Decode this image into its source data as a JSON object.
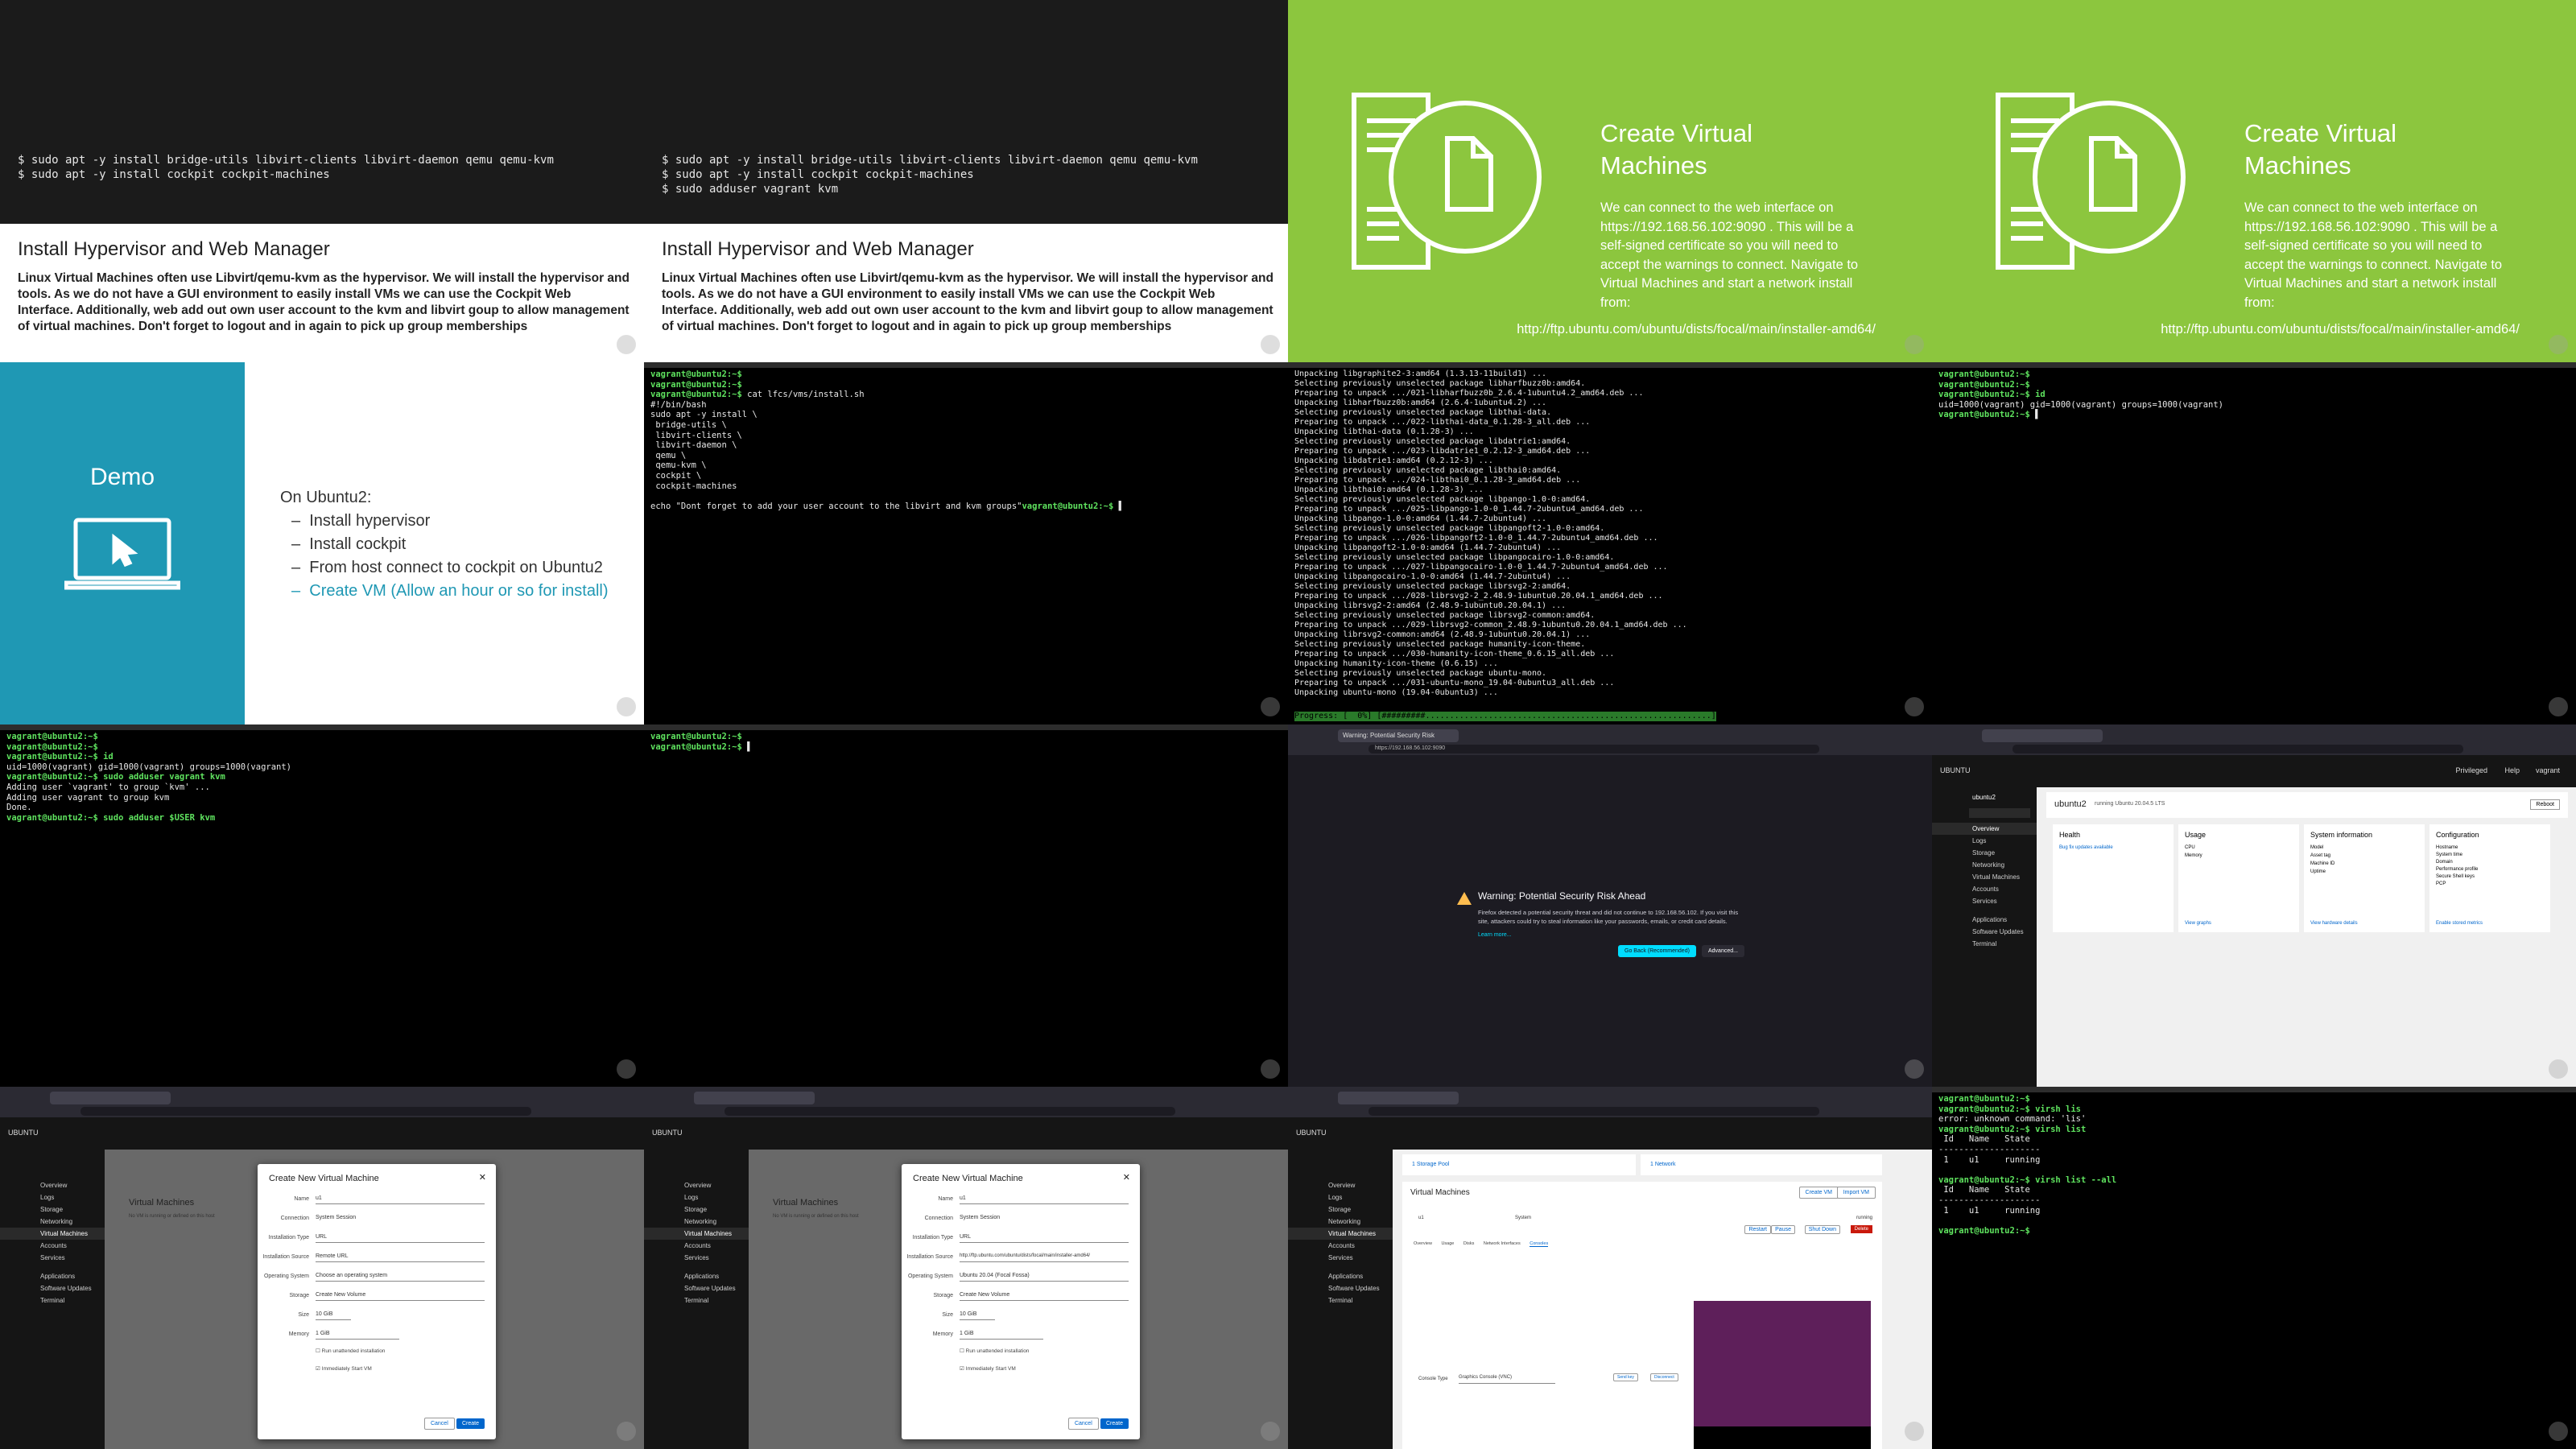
{
  "cells": {
    "c1": {
      "code": "$ sudo apt -y install bridge-utils libvirt-clients libvirt-daemon qemu qemu-kvm\n$ sudo apt -y install cockpit cockpit-machines",
      "title": "Install Hypervisor and Web Manager",
      "body": "Linux Virtual Machines often use Libvirt/qemu-kvm as the hypervisor. We will install the hypervisor and tools. As we do not have a GUI environment to easily install VMs we can use the Cockpit Web Interface. Additionally, web add out own user account to the kvm and libvirt goup to allow management of virtual machines. Don't forget to logout and in again to pick up group memberships"
    },
    "c2": {
      "code": "$ sudo apt -y install bridge-utils libvirt-clients libvirt-daemon qemu qemu-kvm\n$ sudo apt -y install cockpit cockpit-machines\n$ sudo adduser vagrant kvm",
      "title": "Install Hypervisor and Web Manager",
      "body": "Linux Virtual Machines often use Libvirt/qemu-kvm as the hypervisor. We will install the hypervisor and tools. As we do not have a GUI environment to easily install VMs we can use the Cockpit Web Interface. Additionally, web add out own user account to the kvm and libvirt goup to allow management of virtual machines. Don't forget to logout and in again to pick up group memberships"
    },
    "c3": {
      "title": "Create Virtual Machines",
      "text": "We can connect to the web interface on https://192.168.56.102:9090 . This will be a self-signed certificate so you will need to accept the warnings to connect. Navigate to Virtual Machines and start a network install from:",
      "url": "http://ftp.ubuntu.com/ubuntu/dists/focal/main/installer-amd64/"
    },
    "c4": {
      "title": "Create Virtual Machines",
      "text": "We can connect to the web interface on https://192.168.56.102:9090 . This will be a self-signed certificate so you will need to accept the warnings to connect. Navigate to Virtual Machines and start a network install from:",
      "url": "http://ftp.ubuntu.com/ubuntu/dists/focal/main/installer-amd64/"
    },
    "c5": {
      "title": "Demo",
      "intro": "On Ubuntu2:",
      "items": [
        "Install hypervisor",
        "Install cockpit",
        "From host connect to cockpit on Ubuntu2",
        "Create VM (Allow an hour or so for install)"
      ]
    },
    "c6": {
      "prompt": "vagrant@ubuntu2:~$",
      "lines": [
        "",
        "",
        " cat lfcs/vms/install.sh",
        "#!/bin/bash",
        "sudo apt -y install \\",
        " bridge-utils \\",
        " libvirt-clients \\",
        " libvirt-daemon \\",
        " qemu \\",
        " qemu-kvm \\",
        " cockpit \\",
        " cockpit-machines",
        "",
        "echo \"Dont forget to add your user account to the libvirt and kvm groups\""
      ]
    },
    "c7": {
      "output": "Unpacking libgraphite2-3:amd64 (1.3.13-11build1) ...\nSelecting previously unselected package libharfbuzz0b:amd64.\nPreparing to unpack .../021-libharfbuzz0b_2.6.4-1ubuntu4.2_amd64.deb ...\nUnpacking libharfbuzz0b:amd64 (2.6.4-1ubuntu4.2) ...\nSelecting previously unselected package libthai-data.\nPreparing to unpack .../022-libthai-data_0.1.28-3_all.deb ...\nUnpacking libthai-data (0.1.28-3) ...\nSelecting previously unselected package libdatrie1:amd64.\nPreparing to unpack .../023-libdatrie1_0.2.12-3_amd64.deb ...\nUnpacking libdatrie1:amd64 (0.2.12-3) ...\nSelecting previously unselected package libthai0:amd64.\nPreparing to unpack .../024-libthai0_0.1.28-3_amd64.deb ...\nUnpacking libthai0:amd64 (0.1.28-3) ...\nSelecting previously unselected package libpango-1.0-0:amd64.\nPreparing to unpack .../025-libpango-1.0-0_1.44.7-2ubuntu4_amd64.deb ...\nUnpacking libpango-1.0-0:amd64 (1.44.7-2ubuntu4) ...\nSelecting previously unselected package libpangoft2-1.0-0:amd64.\nPreparing to unpack .../026-libpangoft2-1.0-0_1.44.7-2ubuntu4_amd64.deb ...\nUnpacking libpangoft2-1.0-0:amd64 (1.44.7-2ubuntu4) ...\nSelecting previously unselected package libpangocairo-1.0-0:amd64.\nPreparing to unpack .../027-libpangocairo-1.0-0_1.44.7-2ubuntu4_amd64.deb ...\nUnpacking libpangocairo-1.0-0:amd64 (1.44.7-2ubuntu4) ...\nSelecting previously unselected package librsvg2-2:amd64.\nPreparing to unpack .../028-librsvg2-2_2.48.9-1ubuntu0.20.04.1_amd64.deb ...\nUnpacking librsvg2-2:amd64 (2.48.9-1ubuntu0.20.04.1) ...\nSelecting previously unselected package librsvg2-common:amd64.\nPreparing to unpack .../029-librsvg2-common_2.48.9-1ubuntu0.20.04.1_amd64.deb ...\nUnpacking librsvg2-common:amd64 (2.48.9-1ubuntu0.20.04.1) ...\nSelecting previously unselected package humanity-icon-theme.\nPreparing to unpack .../030-humanity-icon-theme_0.6.15_all.deb ...\nUnpacking humanity-icon-theme (0.6.15) ...\nSelecting previously unselected package ubuntu-mono.\nPreparing to unpack .../031-ubuntu-mono_19.04-0ubuntu3_all.deb ...\nUnpacking ubuntu-mono (19.04-0ubuntu3) ...",
      "progress": "Progress: [  0%] [#########...........................................................]"
    },
    "c8": {
      "lines": [
        "vagrant@ubuntu2:~$",
        "vagrant@ubuntu2:~$ id",
        "uid=1000(vagrant) gid=1000(vagrant) groups=1000(vagrant)",
        "vagrant@ubuntu2:~$"
      ]
    },
    "c9": {
      "lines": [
        "vagrant@ubuntu2:~$",
        "vagrant@ubuntu2:~$",
        "vagrant@ubuntu2:~$ id",
        "uid=1000(vagrant) gid=1000(vagrant) groups=1000(vagrant)",
        "vagrant@ubuntu2:~$ sudo adduser vagrant kvm",
        "Adding user `vagrant' to group `kvm' ...",
        "Adding user vagrant to group kvm",
        "Done.",
        "vagrant@ubuntu2:~$ sudo adduser $USER kvm"
      ]
    },
    "c10": {
      "lines": [
        "vagrant@ubuntu2:~$",
        "vagrant@ubuntu2:~$"
      ]
    },
    "c11": {
      "tab": "Warning: Potential Security Risk",
      "url": "https://192.168.56.102:9090",
      "title": "Warning: Potential Security Risk Ahead",
      "text": "Firefox detected a potential security threat and did not continue to 192.168.56.102. If you visit this site, attackers could try to steal information like your passwords, emails, or credit card details.",
      "learn": "Learn more...",
      "back": "Go Back (Recommended)",
      "advanced": "Advanced..."
    },
    "c12": {
      "brand": "UBUNTU",
      "host": "ubuntu2",
      "host_sub": "running Ubuntu 20.04.5 LTS",
      "reboot": "Reboot",
      "nav": [
        "Overview",
        "Logs",
        "Storage",
        "Networking",
        "Virtual Machines",
        "Accounts",
        "Services",
        "Applications",
        "Software Updates",
        "Terminal"
      ],
      "cards": [
        {
          "title": "Health",
          "lines": [
            "Bug fix updates available"
          ],
          "link": ""
        },
        {
          "title": "Usage",
          "lines": [
            "CPU",
            "Memory"
          ],
          "link": "View graphs"
        },
        {
          "title": "System information",
          "lines": [
            "Model",
            "Asset tag",
            "Machine ID",
            "Uptime"
          ],
          "link": "View hardware details"
        },
        {
          "title": "Configuration",
          "lines": [
            "Hostname",
            "System time",
            "Domain",
            "Performance profile",
            "Secure Shell keys",
            "PCP"
          ],
          "link": "Enable stored metrics"
        }
      ],
      "top_priv": "Privileged",
      "top_help": "Help",
      "top_user": "vagrant"
    },
    "c13": {
      "brand": "UBUNTU",
      "page": "Virtual Machines",
      "empty": "No VM is running or defined on this host",
      "modal_title": "Create New Virtual Machine",
      "fields": [
        {
          "label": "Name",
          "value": "u1"
        },
        {
          "label": "Connection",
          "value": "System   Session"
        },
        {
          "label": "Installation Type",
          "value": "URL"
        },
        {
          "label": "Installation Source",
          "value": "Remote URL"
        },
        {
          "label": "Operating System",
          "value": "Choose an operating system"
        },
        {
          "label": "Storage",
          "value": "Create New Volume"
        },
        {
          "label": "Size",
          "value": "10   GiB"
        },
        {
          "label": "Memory",
          "value": "1   GiB"
        }
      ],
      "check1": "Run unattended installation",
      "check2": "Immediately Start VM",
      "cancel": "Cancel",
      "create": "Create"
    },
    "c14": {
      "brand": "UBUNTU",
      "page": "Virtual Machines",
      "empty": "No VM is running or defined on this host",
      "modal_title": "Create New Virtual Machine",
      "fields": [
        {
          "label": "Name",
          "value": "u1"
        },
        {
          "label": "Connection",
          "value": "System   Session"
        },
        {
          "label": "Installation Type",
          "value": "URL"
        },
        {
          "label": "Installation Source",
          "value": "http://ftp.ubuntu.com/ubuntu/dists/focal/main/installer-amd64/"
        },
        {
          "label": "Operating System",
          "value": "Ubuntu 20.04 (Focal Fossa)"
        },
        {
          "label": "Storage",
          "value": "Create New Volume"
        },
        {
          "label": "Size",
          "value": "10   GiB"
        },
        {
          "label": "Memory",
          "value": "1   GiB"
        }
      ],
      "check1": "Run unattended installation",
      "check2": "Immediately Start VM",
      "cancel": "Cancel",
      "create": "Create"
    },
    "c15": {
      "brand": "UBUNTU",
      "pools": "1 Storage Pool",
      "networks": "1 Network",
      "page": "Virtual Machines",
      "create_vm": "Create VM",
      "import_vm": "Import VM",
      "vm_name": "u1",
      "vm_conn": "System",
      "vm_state": "running",
      "reboot": "Restart",
      "pause": "Pause",
      "shutdown": "Shut Down",
      "delete": "Delete",
      "tabs": [
        "Overview",
        "Usage",
        "Disks",
        "Network Interfaces",
        "Consoles"
      ],
      "console_type_label": "Console Type",
      "console_type": "Graphics Console (VNC)",
      "send_key": "Send key",
      "disconnect": "Disconnect"
    },
    "c16": {
      "lines": [
        "vagrant@ubuntu2:~$",
        "vagrant@ubuntu2:~$ virsh lis",
        "error: unknown command: 'lis'",
        "vagrant@ubuntu2:~$ virsh list",
        " Id   Name   State",
        "--------------------",
        " 1    u1     running",
        "",
        "vagrant@ubuntu2:~$ virsh list --all",
        " Id   Name   State",
        "--------------------",
        " 1    u1     running",
        "",
        "vagrant@ubuntu2:~$"
      ]
    }
  },
  "colors": {
    "slide_green": "#8cc63e",
    "demo_teal": "#1f98b4",
    "prompt_green": "#5fe35f",
    "cockpit_blue": "#0066cc",
    "delete_red": "#c9190b",
    "console_purple": "#5e1f5a"
  }
}
